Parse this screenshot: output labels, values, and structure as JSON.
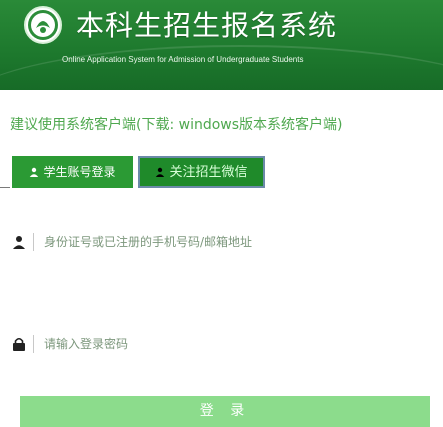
{
  "header": {
    "title": "本科生招生报名系统",
    "subtitle": "Online Application System for Admission of Undergraduate Students"
  },
  "notice": {
    "text": "建议使用系统客户端(下载: windows版本系统客户端)"
  },
  "tabs": [
    {
      "label": "学生账号登录",
      "icon": "user-icon",
      "active": false
    },
    {
      "label": "关注招生微信",
      "icon": "user-icon",
      "active": true
    }
  ],
  "form": {
    "username": {
      "placeholder": "身份证号或已注册的手机号码/邮箱地址",
      "icon": "user-icon"
    },
    "password": {
      "placeholder": "请输入登录密码",
      "icon": "lock-icon"
    }
  },
  "login_button": {
    "label": "登 录"
  },
  "colors": {
    "header_green": "#1e7a2e",
    "tab_green": "#2b9a34",
    "notice_green": "#4fa84f",
    "button_green": "#8cdc8c"
  }
}
